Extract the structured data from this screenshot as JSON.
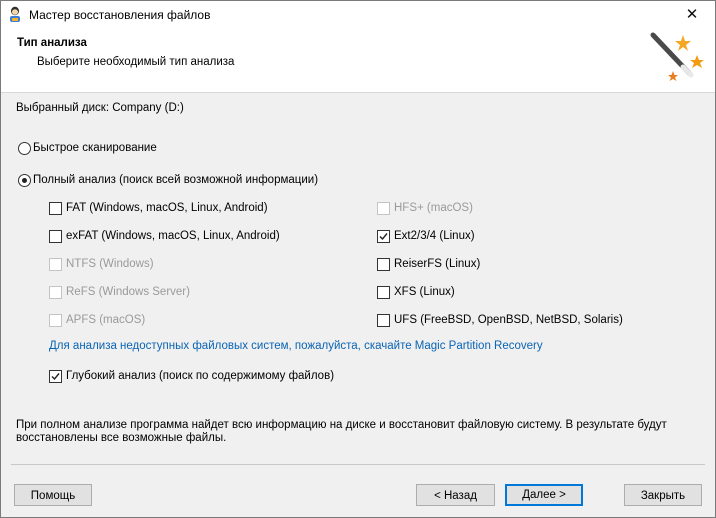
{
  "window": {
    "title": "Мастер восстановления файлов",
    "close_glyph": "✕"
  },
  "header": {
    "title": "Тип анализа",
    "subtitle": "Выберите необходимый тип анализа"
  },
  "disk": {
    "label": "Выбранный диск: Company (D:)"
  },
  "scan_options": {
    "quick": {
      "label": "Быстрое сканирование",
      "selected": false
    },
    "full": {
      "label": "Полный анализ (поиск всей возможной информации)",
      "selected": true
    }
  },
  "filesystems_left": [
    {
      "label": "FAT (Windows, macOS, Linux, Android)",
      "checked": false,
      "enabled": true
    },
    {
      "label": "exFAT (Windows, macOS, Linux, Android)",
      "checked": false,
      "enabled": true
    },
    {
      "label": "NTFS (Windows)",
      "checked": false,
      "enabled": false
    },
    {
      "label": "ReFS (Windows Server)",
      "checked": false,
      "enabled": false
    },
    {
      "label": "APFS (macOS)",
      "checked": false,
      "enabled": false
    }
  ],
  "filesystems_right": [
    {
      "label": "HFS+ (macOS)",
      "checked": false,
      "enabled": false
    },
    {
      "label": "Ext2/3/4 (Linux)",
      "checked": true,
      "enabled": true
    },
    {
      "label": "ReiserFS (Linux)",
      "checked": false,
      "enabled": true
    },
    {
      "label": "XFS (Linux)",
      "checked": false,
      "enabled": true
    },
    {
      "label": "UFS (FreeBSD, OpenBSD, NetBSD, Solaris)",
      "checked": false,
      "enabled": true
    }
  ],
  "partition_link": "Для анализа недоступных файловых систем, пожалуйста, скачайте Magic Partition Recovery",
  "deep_scan": {
    "label": "Глубокий анализ (поиск по содержимому файлов)",
    "checked": true
  },
  "info_text": {
    "line1": "При полном анализе программа найдет всю информацию на диске и восстановит файловую систему. В результате будут",
    "line2": "восстановлены все возможные файлы."
  },
  "buttons": {
    "help": "Помощь",
    "back": "< Назад",
    "next": "Далее >",
    "close": "Закрыть"
  },
  "icons": {
    "app": "recovery-wizard-icon",
    "header": "magic-wand-icon",
    "close": "close-icon"
  }
}
